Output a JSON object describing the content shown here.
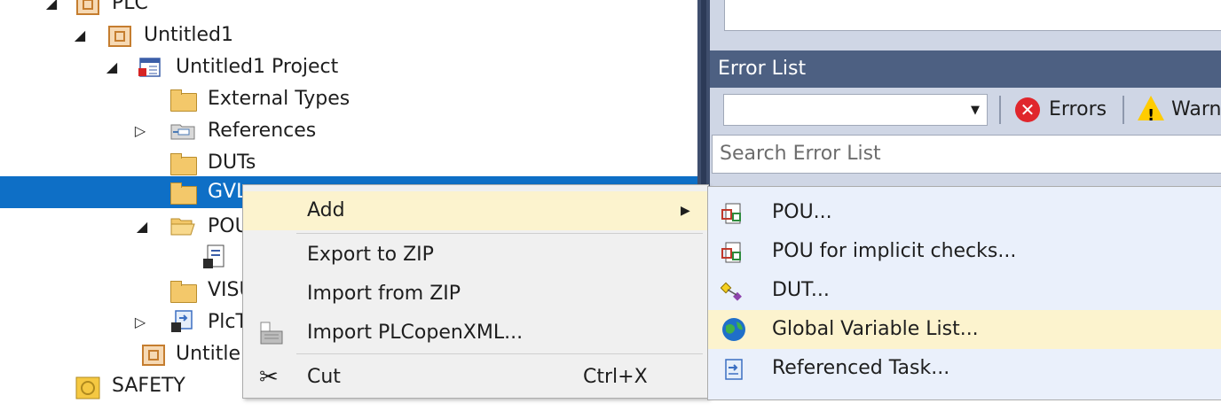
{
  "tree": {
    "items": [
      {
        "label": "PLC",
        "icon": "plc-icon",
        "expander": "expanded"
      },
      {
        "label": "Untitled1",
        "icon": "plc-project-icon",
        "expander": "expanded"
      },
      {
        "label": "Untitled1 Project",
        "icon": "project-file-icon",
        "expander": "expanded"
      },
      {
        "label": "External Types",
        "icon": "folder-icon",
        "expander": ""
      },
      {
        "label": "References",
        "icon": "references-icon",
        "expander": "collapsed"
      },
      {
        "label": "DUTs",
        "icon": "folder-icon",
        "expander": ""
      },
      {
        "label": "GVL",
        "icon": "folder-icon",
        "expander": "",
        "selected": true
      },
      {
        "label": "POU",
        "icon": "folder-open-icon",
        "expander": "expanded"
      },
      {
        "label": "",
        "icon": "pou-document-icon",
        "expander": ""
      },
      {
        "label": "VISU",
        "icon": "folder-icon",
        "expander": ""
      },
      {
        "label": "PlcT",
        "icon": "task-icon",
        "expander": "collapsed"
      },
      {
        "label": "Untitle",
        "icon": "plc-instance-icon",
        "expander": ""
      },
      {
        "label": "SAFETY",
        "icon": "safety-icon",
        "expander": ""
      }
    ]
  },
  "error_list": {
    "title": "Error List",
    "filter_value": "",
    "errors_label": "Errors",
    "warnings_label": "Warn",
    "search_placeholder": "Search Error List"
  },
  "context_menu": {
    "items": [
      {
        "label": "Add",
        "shortcut": "",
        "has_submenu": true,
        "highlighted": true
      },
      {
        "label": "Export to ZIP",
        "shortcut": ""
      },
      {
        "label": "Import from ZIP",
        "shortcut": ""
      },
      {
        "label": "Import PLCopenXML...",
        "shortcut": "",
        "icon": "import-xml-icon"
      },
      {
        "label": "Cut",
        "shortcut": "Ctrl+X",
        "icon": "scissors-icon"
      }
    ]
  },
  "submenu": {
    "items": [
      {
        "label": "POU...",
        "icon": "pou-icon"
      },
      {
        "label": "POU for implicit checks...",
        "icon": "pou-checks-icon"
      },
      {
        "label": "DUT...",
        "icon": "dut-icon"
      },
      {
        "label": "Global Variable List...",
        "icon": "globe-icon",
        "highlighted": true
      },
      {
        "label": "Referenced Task...",
        "icon": "referenced-task-icon"
      }
    ]
  },
  "colors": {
    "selection": "#0e6fc6",
    "menu_highlight": "#fcf3ce",
    "panel_header": "#4d6082",
    "error_red": "#e0262c",
    "warning_yellow": "#ffcc00"
  }
}
